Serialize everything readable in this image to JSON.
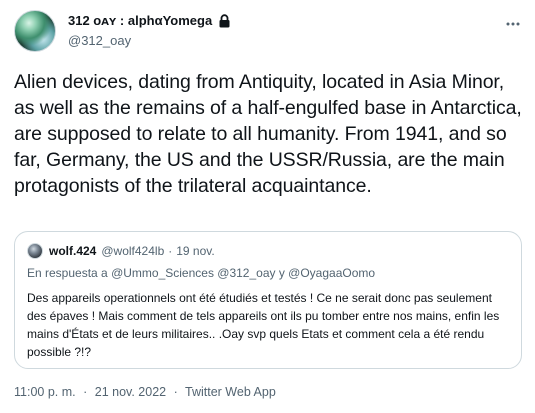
{
  "tweet": {
    "author": {
      "display_name": "312 ᴏᴀʏ : alphαYomega",
      "handle": "@312_oay",
      "protected": true
    },
    "text": "Alien devices, dating from Antiquity, located in Asia Minor, as well as the remains of a half-engulfed base in Antarctica, are supposed to relate to all humanity. From 1941, and so far, Germany, the US and the USSR/Russia, are the main protagonists of the trilateral acquaintance.",
    "more_icon": "more-horizontal-icon",
    "lock_icon": "lock-icon",
    "quoted": {
      "display_name": "wolf.424",
      "handle": "@wolf424lb",
      "separator": "·",
      "date": "19 nov.",
      "reply_prefix": "En respuesta a",
      "reply_mentions": "@Ummo_Sciences @312_oay y @OyagaaOomo",
      "text": "Des appareils operationnels ont été étudiés et testés ! Ce ne serait donc pas seulement des épaves ! Mais comment de tels appareils ont ils pu tomber entre nos mains, enfin les mains d'États et de leurs militaires.. .Oay svp quels Etats et comment cela a été rendu possible ?!?"
    },
    "footer": {
      "time": "11:00 p. m.",
      "separator": "·",
      "date": "21 nov. 2022",
      "source": "Twitter Web App"
    }
  },
  "colors": {
    "text_primary": "#0f1419",
    "text_secondary": "#536471",
    "border": "#cfd9de"
  }
}
